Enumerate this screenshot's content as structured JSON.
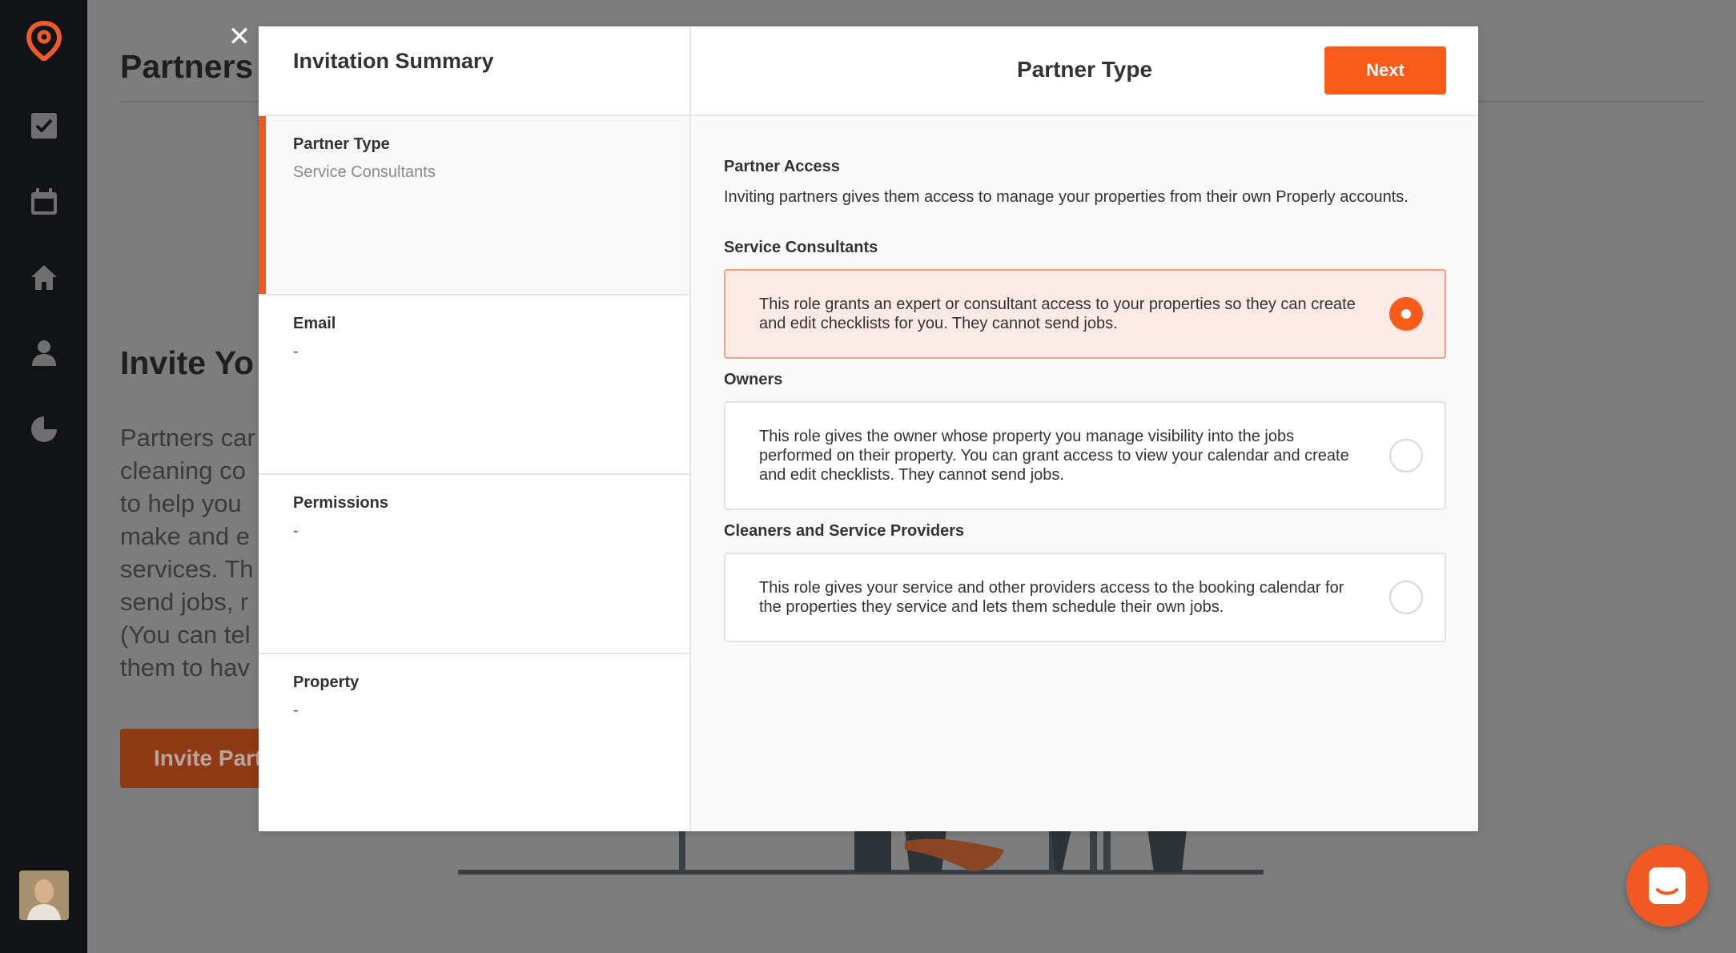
{
  "background": {
    "title": "Partners",
    "heading": "Invite Yo",
    "paragraph_lines": [
      "Partners car",
      "cleaning co",
      "to help you",
      "make and e",
      "services. Th",
      "send jobs, r",
      "(You can tel",
      "them to hav"
    ],
    "button_label": "Invite Part"
  },
  "modal": {
    "close_symbol": "✕",
    "summary": {
      "title": "Invitation Summary",
      "sections": [
        {
          "label": "Partner Type",
          "value": "Service Consultants"
        },
        {
          "label": "Email",
          "value": "-"
        },
        {
          "label": "Permissions",
          "value": "-"
        },
        {
          "label": "Property",
          "value": "-"
        }
      ]
    },
    "header": {
      "title": "Partner Type",
      "next_label": "Next"
    },
    "access": {
      "title": "Partner Access",
      "description": "Inviting partners gives them access to manage your properties from their own Properly accounts."
    },
    "groups": [
      {
        "title": "Service Consultants",
        "text": "This role grants an expert or consultant access to your properties so they can create and edit checklists for you. They cannot send jobs.",
        "selected": true
      },
      {
        "title": "Owners",
        "text": "This role gives the owner whose property you manage visibility into the jobs performed on their property. You can grant access to view your calendar and create and edit checklists. They cannot send jobs.",
        "selected": false
      },
      {
        "title": "Cleaners and Service Providers",
        "text": "This role gives your service and other providers access to the booking calendar for the properties they service and lets them schedule their own jobs.",
        "selected": false
      }
    ]
  },
  "sidebar": {
    "icons": [
      "location-pin-logo-icon",
      "checkbox-icon",
      "calendar-icon",
      "home-icon",
      "user-icon",
      "pie-chart-icon"
    ]
  },
  "colors": {
    "accent": "#fa5b19",
    "selected_bg": "#fde9e5",
    "sidebar": "#111316"
  }
}
